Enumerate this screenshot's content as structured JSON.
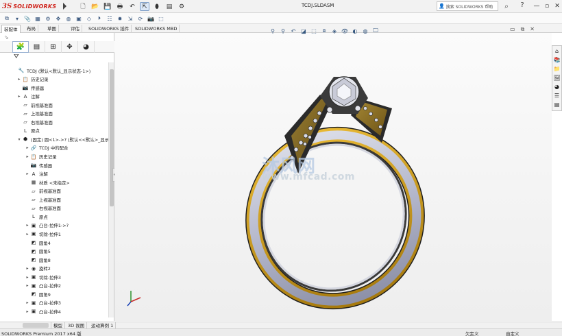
{
  "app": {
    "logo_text": "SOLIDWORKS",
    "doc_title": "TCDJ.SLDASM",
    "search_placeholder": "搜索 SOLIDWORKS 帮助",
    "help_label": "?",
    "minimize": "—",
    "restore": "▫",
    "close": "✕"
  },
  "tabs": [
    "装配体",
    "布局",
    "草图",
    "评估",
    "SOLIDWORKS 插件",
    "SOLIDWORKS MBD"
  ],
  "tree": [
    {
      "level": 0,
      "tw": "",
      "icon": "🔧",
      "label": "TCDJ  (默认<默认_显示状态-1>)"
    },
    {
      "level": 1,
      "tw": "▸",
      "icon": "📋",
      "label": "历史记录"
    },
    {
      "level": 1,
      "tw": "",
      "icon": "📷",
      "label": "传感器"
    },
    {
      "level": 1,
      "tw": "▸",
      "icon": "A",
      "label": "注解"
    },
    {
      "level": 1,
      "tw": "",
      "icon": "▱",
      "label": "前视基准面"
    },
    {
      "level": 1,
      "tw": "",
      "icon": "▱",
      "label": "上视基准面"
    },
    {
      "level": 1,
      "tw": "",
      "icon": "▱",
      "label": "右视基准面"
    },
    {
      "level": 1,
      "tw": "",
      "icon": "L",
      "label": "原点"
    },
    {
      "level": 1,
      "tw": "▾",
      "icon": "⬢",
      "label": "(固定) 圆<1>->? (默认<<默认>_显示"
    },
    {
      "level": 2,
      "tw": "▸",
      "icon": "🔗",
      "label": "TCDJ 中的配合"
    },
    {
      "level": 2,
      "tw": "▸",
      "icon": "📋",
      "label": "历史记录"
    },
    {
      "level": 2,
      "tw": "",
      "icon": "📷",
      "label": "传感器"
    },
    {
      "level": 2,
      "tw": "▸",
      "icon": "A",
      "label": "注解"
    },
    {
      "level": 2,
      "tw": "",
      "icon": "▦",
      "label": "材质 <未指定>"
    },
    {
      "level": 2,
      "tw": "",
      "icon": "▱",
      "label": "前视基准面"
    },
    {
      "level": 2,
      "tw": "",
      "icon": "▱",
      "label": "上视基准面"
    },
    {
      "level": 2,
      "tw": "",
      "icon": "▱",
      "label": "右视基准面"
    },
    {
      "level": 2,
      "tw": "",
      "icon": "L",
      "label": "原点"
    },
    {
      "level": 2,
      "tw": "▸",
      "icon": "▣",
      "label": "凸台-拉伸1->?"
    },
    {
      "level": 2,
      "tw": "▸",
      "icon": "▣",
      "label": "切除-拉伸1"
    },
    {
      "level": 2,
      "tw": "",
      "icon": "◩",
      "label": "圆角4"
    },
    {
      "level": 2,
      "tw": "",
      "icon": "◩",
      "label": "圆角5"
    },
    {
      "level": 2,
      "tw": "",
      "icon": "◩",
      "label": "圆角8"
    },
    {
      "level": 2,
      "tw": "▸",
      "icon": "◉",
      "label": "旋转2"
    },
    {
      "level": 2,
      "tw": "▸",
      "icon": "▣",
      "label": "切除-拉伸3"
    },
    {
      "level": 2,
      "tw": "▸",
      "icon": "▣",
      "label": "凸台-拉伸2"
    },
    {
      "level": 2,
      "tw": "",
      "icon": "◩",
      "label": "圆角9"
    },
    {
      "level": 2,
      "tw": "▸",
      "icon": "▣",
      "label": "凸台-拉伸3"
    },
    {
      "level": 2,
      "tw": "▸",
      "icon": "▣",
      "label": "凸台-拉伸4"
    }
  ],
  "bottom_tabs": [
    "模型",
    "3D 视图",
    "运动算例 1"
  ],
  "status": {
    "app": "SOLIDWORKS Premium 2017 x64 版",
    "defined": "欠定义",
    "custom": "自定义"
  },
  "watermark": {
    "cn": "沐风网",
    "en": "www.mfcad.com"
  },
  "colors": {
    "gold": "#c9960f",
    "silver": "#b9bccf",
    "accent": "#d0251d"
  }
}
